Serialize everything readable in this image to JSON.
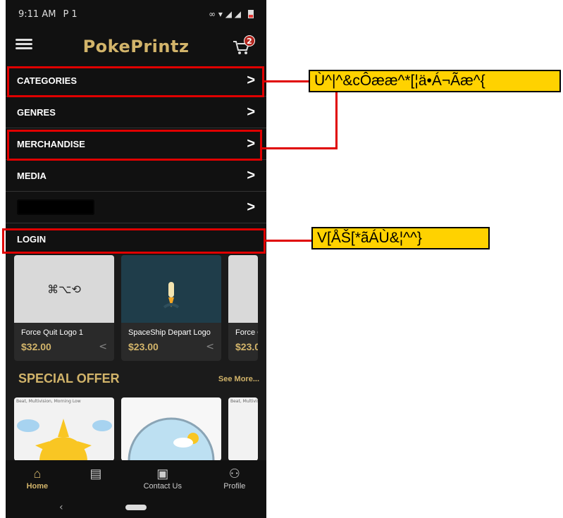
{
  "status_bar": {
    "time": "9:11 AM",
    "left_icons": "P 1",
    "right_icons": "∞ ▾ ◢ ◢"
  },
  "app": {
    "title": "PokePrintz",
    "cart_count": "2"
  },
  "menu": {
    "categories": "CATEGORIES",
    "genres": "GENRES",
    "merchandise": "MERCHANDISE",
    "media": "MEDIA",
    "login": "LOGIN",
    "chevron": ">"
  },
  "products": [
    {
      "name": "Force Quit Logo 1",
      "price": "$32.00",
      "glyphs": "⌘⌥⟲"
    },
    {
      "name": "SpaceShip Depart Logo",
      "price": "$23.00"
    },
    {
      "name": "Force Q",
      "price": "$23.0"
    }
  ],
  "special_offer": {
    "title": "SPECIAL OFFER",
    "see_more": "See More...",
    "tag": "Beat, Multivision, Morning Low"
  },
  "bottom_nav": {
    "home": "Home",
    "contact": "Contact Us",
    "profile": "Profile"
  },
  "annotations": {
    "note_1": "Ù^|^&cÔææ^*[¦ä•Á¬Ãæ^{",
    "note_2": "V[ÅŠ[*ãÁÙ&¦^^}"
  },
  "colors": {
    "accent": "#d2b46a",
    "annotation_red": "#e00000",
    "annotation_yellow": "#ffd200"
  }
}
